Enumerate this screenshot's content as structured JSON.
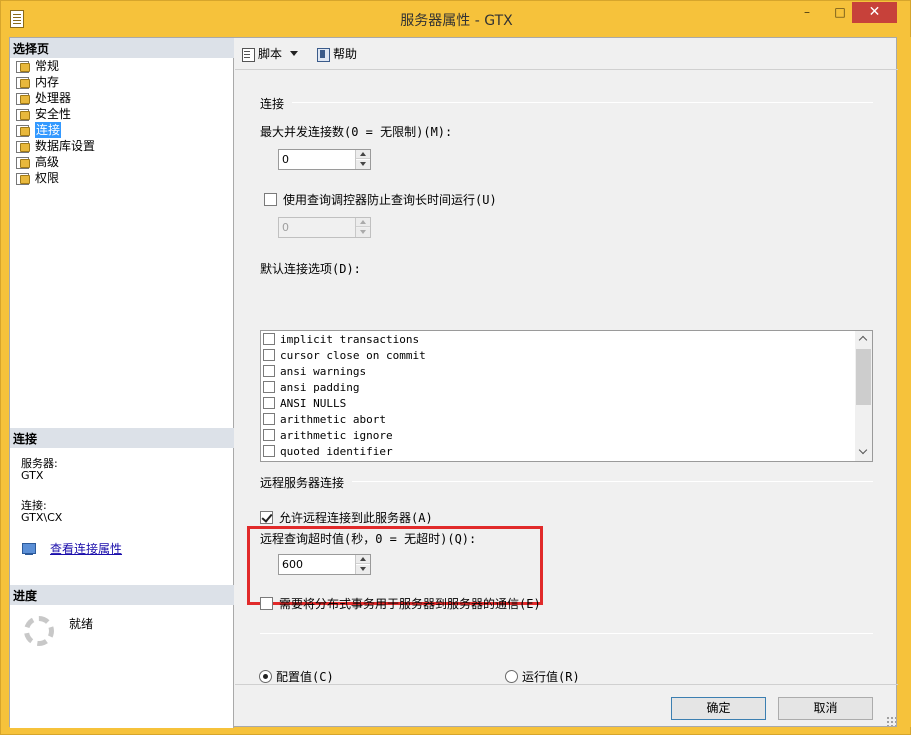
{
  "window": {
    "title": "服务器属性 - GTX",
    "minimize": "–",
    "maximize": "□",
    "close": "✕"
  },
  "sidebar": {
    "select_page_header": "选择页",
    "pages": [
      "常规",
      "内存",
      "处理器",
      "安全性",
      "连接",
      "数据库设置",
      "高级",
      "权限"
    ],
    "selected_page": "连接",
    "connection_header": "连接",
    "server_label": "服务器:",
    "server_value": "GTX",
    "connection_label": "连接:",
    "connection_value": "GTX\\CX",
    "view_props_link": "查看连接属性",
    "progress_header": "进度",
    "progress_status": "就绪"
  },
  "toolbar": {
    "script_label": "脚本",
    "help_label": "帮助"
  },
  "connections": {
    "group_title": "连接",
    "max_conn_label": "最大并发连接数(0 = 无限制)(M):",
    "max_conn_value": "0",
    "query_governor_label": "使用查询调控器防止查询长时间运行(U)",
    "query_governor_checked": false,
    "query_governor_value": "0",
    "default_options_label": "默认连接选项(D):",
    "default_options": [
      {
        "label": "implicit transactions",
        "checked": false
      },
      {
        "label": "cursor close on commit",
        "checked": false
      },
      {
        "label": "ansi warnings",
        "checked": false
      },
      {
        "label": "ansi padding",
        "checked": false
      },
      {
        "label": "ANSI NULLS",
        "checked": false
      },
      {
        "label": "arithmetic abort",
        "checked": false
      },
      {
        "label": "arithmetic ignore",
        "checked": false
      },
      {
        "label": "quoted identifier",
        "checked": false
      }
    ]
  },
  "remote": {
    "group_title": "远程服务器连接",
    "allow_remote_label": "允许远程连接到此服务器(A)",
    "allow_remote_checked": true,
    "timeout_label": "远程查询超时值(秒，0 = 无超时)(Q):",
    "timeout_value": "600",
    "distributed_tx_label": "需要将分布式事务用于服务器到服务器的通信(E)",
    "distributed_tx_checked": false
  },
  "value_mode": {
    "configured_label": "配置值(C)",
    "running_label": "运行值(R)",
    "selected": "configured"
  },
  "buttons": {
    "ok": "确定",
    "cancel": "取消"
  },
  "colors": {
    "title_bar": "#f6c23b",
    "selection": "#3399ff",
    "highlight_box": "#e12a2a",
    "close_button": "#c7413a"
  }
}
